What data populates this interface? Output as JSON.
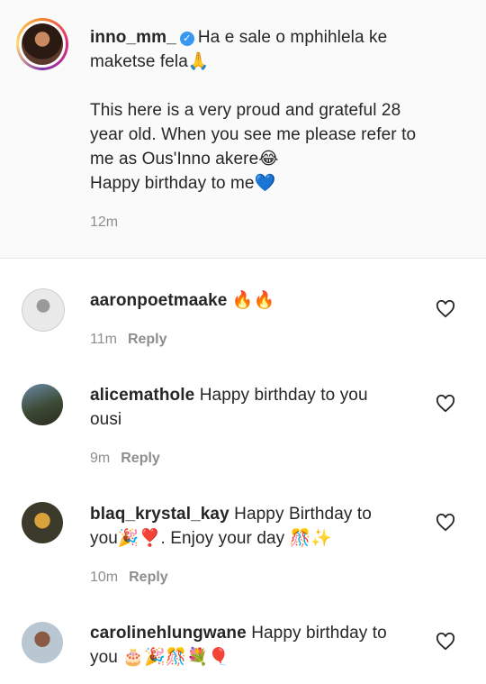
{
  "post": {
    "username": "inno_mm_",
    "line1": "Ha e sale o mphihlela ke",
    "line2": "maketse fela🙏",
    "line3": "This here is a very proud and grateful 28",
    "line4": "year old. When you see me please refer to",
    "line5": "me as Ous'Inno akere😂",
    "line6": "Happy birthday to me💙",
    "time": "12m"
  },
  "comments": [
    {
      "username": "aaronpoetmaake",
      "text_inline": "🔥🔥",
      "text_line2": "",
      "time": "11m",
      "reply": "Reply"
    },
    {
      "username": "alicemathole",
      "text_inline": "Happy birthday to you",
      "text_line2": "ousi",
      "time": "9m",
      "reply": "Reply"
    },
    {
      "username": "blaq_krystal_kay",
      "text_inline": "Happy Birthday to",
      "text_line2": "you🎉❣️. Enjoy your day 🎊✨",
      "time": "10m",
      "reply": "Reply"
    },
    {
      "username": "carolinehlungwane",
      "text_inline": "Happy birthday to",
      "text_line2": "you 🎂🎉🎊💐🎈",
      "time": "",
      "reply": ""
    }
  ],
  "colors": {
    "text": "#262626",
    "meta": "#8e8e8e",
    "verified": "#3897f0",
    "caption_bg": "#fafafa"
  }
}
